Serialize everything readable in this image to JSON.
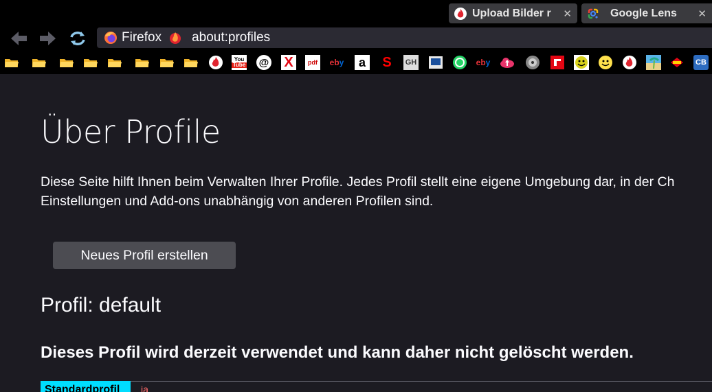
{
  "tabs": [
    {
      "title": "Upload Bilder r",
      "favicon": "upload-flame-icon",
      "close": "✕"
    },
    {
      "title": "Google Lens",
      "favicon": "google-lens-icon",
      "close": "✕"
    }
  ],
  "nav": {
    "identity_label": "Firefox",
    "url": "about:profiles"
  },
  "bookmarks": [
    {
      "name": "folder",
      "icon": "folder-icon"
    },
    {
      "name": "folder",
      "icon": "folder-icon"
    },
    {
      "name": "folder",
      "icon": "folder-icon"
    },
    {
      "name": "folder",
      "icon": "folder-icon"
    },
    {
      "name": "folder",
      "icon": "folder-icon"
    },
    {
      "name": "folder",
      "icon": "folder-icon"
    },
    {
      "name": "folder",
      "icon": "folder-icon"
    },
    {
      "name": "folder",
      "icon": "folder-icon"
    },
    {
      "name": "flame",
      "icon": "flame-icon"
    },
    {
      "name": "youtube",
      "icon": "youtube-icon",
      "text": "You Tube"
    },
    {
      "name": "circle-e",
      "icon": "circle-e-icon",
      "text": "@"
    },
    {
      "name": "x",
      "icon": "x-icon",
      "text": "X"
    },
    {
      "name": "pdf",
      "icon": "pdf-icon",
      "text": "pdf"
    },
    {
      "name": "ebay",
      "icon": "ebay-icon",
      "text": "eb"
    },
    {
      "name": "amazon",
      "icon": "amazon-icon",
      "text": "a"
    },
    {
      "name": "sparkasse",
      "icon": "sparkasse-icon",
      "text": "S"
    },
    {
      "name": "gh",
      "icon": "gh-icon",
      "text": "GH"
    },
    {
      "name": "monitor",
      "icon": "monitor-icon"
    },
    {
      "name": "whatsapp",
      "icon": "whatsapp-icon"
    },
    {
      "name": "ebay2",
      "icon": "ebay-icon",
      "text": "eb"
    },
    {
      "name": "cloud",
      "icon": "cloud-upload-icon"
    },
    {
      "name": "disc",
      "icon": "disc-icon"
    },
    {
      "name": "red-app",
      "icon": "red-app-icon"
    },
    {
      "name": "smiley-black",
      "icon": "smiley-icon"
    },
    {
      "name": "smiley-yellow",
      "icon": "smiley-icon"
    },
    {
      "name": "flame2",
      "icon": "flame-icon"
    },
    {
      "name": "beach",
      "icon": "beach-icon"
    },
    {
      "name": "fritz",
      "icon": "fritz-icon"
    },
    {
      "name": "cb",
      "icon": "cb-icon",
      "text": "CB"
    }
  ],
  "page": {
    "title": "Über Profile",
    "intro_line1": "Diese Seite hilft Ihnen beim Verwalten Ihrer Profile. Jedes Profil stellt eine eigene Umgebung dar, in der Ch",
    "intro_line2": "Einstellungen und Add-ons unabhängig von anderen Profilen sind.",
    "create_button": "Neues Profil erstellen",
    "profile_heading": "Profil: default",
    "in_use_note": "Dieses Profil wird derzeit verwendet und kann daher nicht gelöscht werden.",
    "table_first_cell": "Standardprofil",
    "table_first_value": "ja"
  },
  "colors": {
    "background": "#1c1b22",
    "accent": "#00ddff",
    "button": "#4c4c52"
  }
}
